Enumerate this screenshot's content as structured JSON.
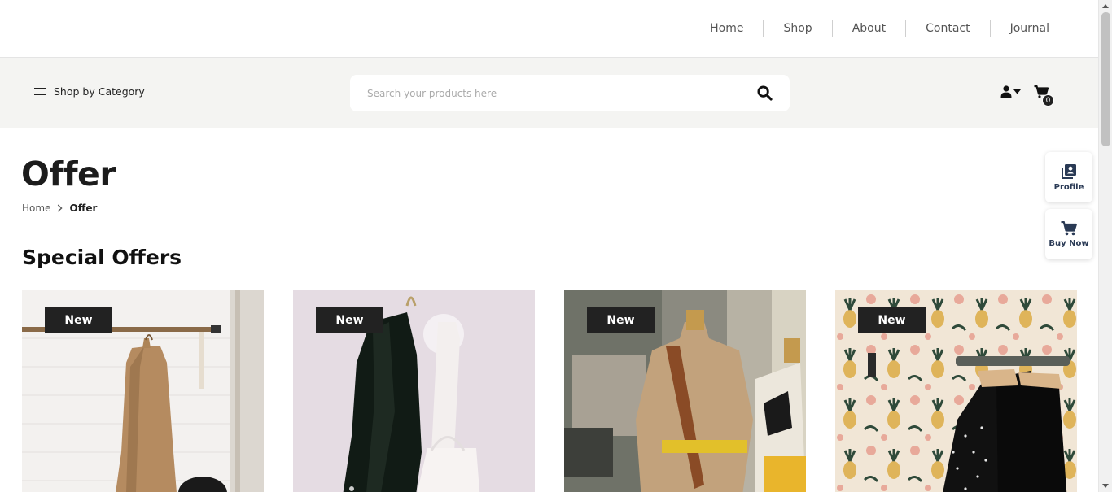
{
  "nav": {
    "items": [
      {
        "label": "Home"
      },
      {
        "label": "Shop"
      },
      {
        "label": "About"
      },
      {
        "label": "Contact"
      },
      {
        "label": "Journal"
      }
    ]
  },
  "header": {
    "category_label": "Shop by Category",
    "search_placeholder": "Search your products here",
    "search_value": "",
    "cart_count": "0"
  },
  "page": {
    "title": "Offer",
    "breadcrumb": {
      "home": "Home",
      "current": "Offer"
    },
    "section_title": "Special Offers"
  },
  "products": [
    {
      "badge": "New",
      "image": "beige-trench-coat-on-rack"
    },
    {
      "badge": "New",
      "image": "black-coat-and-white-bag-on-hook"
    },
    {
      "badge": "New",
      "image": "trench-coat-on-mannequin-in-window"
    },
    {
      "badge": "New",
      "image": "black-tops-on-pineapple-wallpaper"
    }
  ],
  "floating": {
    "profile_label": "Profile",
    "buy_label": "Buy Now"
  },
  "colors": {
    "dark": "#222222",
    "band_bg": "#f4f4f2",
    "float_text": "#2a3a55"
  }
}
